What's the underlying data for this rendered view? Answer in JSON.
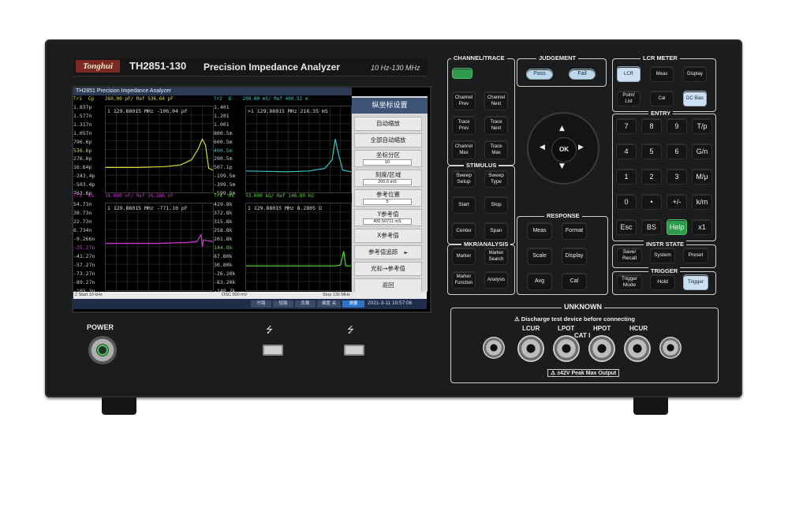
{
  "brand": {
    "logo": "Tonghui",
    "model": "TH2851-130",
    "title": "Precision Impedance  Analyzer",
    "freq_range": "10 Hz-130 MHz"
  },
  "screen": {
    "title": "TH2851 Precision Impedance Analyzer",
    "traces": [
      {
        "id": "Tr1",
        "param": "Cp",
        "scale": "260.00  pF/ Ref  536.64 pF",
        "color": "#d8d838",
        "ticks": [
          "1.837p",
          "1.577n",
          "1.317n",
          "1.057n",
          "796.6p",
          "536.6p",
          "276.6p",
          "16.64p",
          "-243.4p",
          "-503.4p",
          "763.6p"
        ],
        "marker": "1   129.88015 MHz   -106.04 pF",
        "curve": [
          [
            0,
            0.71
          ],
          [
            0.3,
            0.71
          ],
          [
            0.55,
            0.7
          ],
          [
            0.7,
            0.68
          ],
          [
            0.8,
            0.62
          ],
          [
            0.86,
            0.5
          ],
          [
            0.9,
            0.38
          ],
          [
            0.93,
            0.45
          ],
          [
            0.96,
            0.72
          ],
          [
            1,
            0.74
          ]
        ]
      },
      {
        "id": "Tr2",
        "param": "D",
        "scale": "200.00  mS/ Ref  400.51 m",
        "color": "#38c8c8",
        "ticks": [
          "1.401",
          "1.201",
          "1.001",
          "800.5m",
          "600.5m",
          "400.5m",
          "200.5m",
          "507.1p",
          "-199.5m",
          "-399.5m",
          "-599.5m"
        ],
        "marker": ">1   129.88015 MHz   216.35 mS",
        "curve": [
          [
            0,
            0.75
          ],
          [
            0.4,
            0.76
          ],
          [
            0.6,
            0.75
          ],
          [
            0.75,
            0.72
          ],
          [
            0.82,
            0.62
          ],
          [
            0.85,
            0.38
          ],
          [
            0.88,
            0.55
          ],
          [
            0.92,
            0.74
          ],
          [
            1,
            0.76
          ]
        ]
      },
      {
        "id": "Tr3",
        "param": "Cs",
        "scale": "16.000  nF/ Ref  26.266 nF",
        "color": "#d838d8",
        "ticks": [
          "54.73n",
          "38.73n",
          "22.73n",
          "6.734n",
          "-9.266n",
          "-25.27n",
          "-41.27n",
          "-57.27n",
          "-73.27n",
          "-89.27n",
          "-105.3n"
        ],
        "marker": "1   129.88015 MHz   -771.10 pF",
        "curve": [
          [
            0,
            0.46
          ],
          [
            0.5,
            0.46
          ],
          [
            0.75,
            0.45
          ],
          [
            0.85,
            0.44
          ],
          [
            0.89,
            0.36
          ],
          [
            0.9,
            0.5
          ],
          [
            0.91,
            0.42
          ],
          [
            0.95,
            0.43
          ],
          [
            1,
            0.44
          ]
        ]
      },
      {
        "id": "Tr4",
        "param": "Rs",
        "scale": "53.000  kΩ/ Ref  148.80 kΩ",
        "color": "#58d838",
        "ticks": [
          "429.8k",
          "372.8k",
          "315.8k",
          "258.8k",
          "201.8k",
          "144.8k",
          "87.80k",
          "30.80k",
          "-26.20k",
          "-83.20k",
          "-140.2k"
        ],
        "marker": "1   129.88015 MHz   8.2805 Ω",
        "curve": [
          [
            0,
            0.72
          ],
          [
            0.7,
            0.72
          ],
          [
            0.85,
            0.72
          ],
          [
            0.9,
            0.71
          ],
          [
            0.93,
            0.55
          ],
          [
            0.95,
            0.72
          ],
          [
            1,
            0.72
          ]
        ]
      }
    ],
    "status": {
      "start": "2  Start  10 kHz",
      "osc": "OSC 500 mV",
      "stop": "Stop  130 MHz"
    },
    "taskbar": [
      "开路",
      "短路",
      "负载",
      "偏置 关",
      "测量"
    ],
    "clock": "2021-3-11  10:57:06",
    "softmenu": {
      "title": "纵坐标设置",
      "items": [
        {
          "label": "自动缩放"
        },
        {
          "label": "全部自动缩放"
        },
        {
          "label": "坐标分区",
          "value": "10"
        },
        {
          "label": "刻度/区域",
          "value": "200.0 mS"
        },
        {
          "label": "参考位置",
          "value": "5"
        },
        {
          "label": "Y参考值",
          "value": "400.50711 mS"
        },
        {
          "label": "X参考值"
        },
        {
          "label": "参考值追踪",
          "arrow": "►"
        },
        {
          "label": "光标→参考值"
        },
        {
          "label": "返回"
        }
      ]
    }
  },
  "panel": {
    "power": "POWER",
    "channel": {
      "title": "CHANNEL/TRACE",
      "buttons": [
        "Channel\nPrev",
        "Channel\nNext",
        "Trace\nPrev",
        "Trace\nNext",
        "Channel\nMax",
        "Trace\nMax"
      ]
    },
    "judgement": {
      "title": "JUDGEMENT",
      "buttons": [
        "Pass",
        "Fail"
      ]
    },
    "lcr": {
      "title": "LCR METER",
      "buttons": [
        "LCR",
        "Meas",
        "Display",
        "Point/\nList",
        "Cal",
        "DC Bias"
      ]
    },
    "entry": {
      "title": "ENTRY",
      "keys": [
        "7",
        "8",
        "9",
        "T/p",
        "4",
        "5",
        "6",
        "G/n",
        "1",
        "2",
        "3",
        "M/μ",
        "0",
        "•",
        "+/-",
        "k/m",
        "Esc",
        "BS",
        "Help",
        "x1"
      ]
    },
    "stimulus": {
      "title": "STIMULUS",
      "buttons": [
        "Sweep\nSetup",
        "Sweep\nType",
        "Start",
        "Stop",
        "Center",
        "Span"
      ]
    },
    "nav": {
      "ok": "OK",
      "arrows": [
        "▲",
        "▼",
        "◀",
        "▶"
      ]
    },
    "response": {
      "title": "RESPONSE",
      "buttons": [
        "Meas",
        "Format",
        "Scale",
        "Display",
        "Avg",
        "Cal"
      ]
    },
    "mkr": {
      "title": "MKR/ANALYSIS",
      "buttons": [
        "Marker",
        "Marker\nSearch",
        "Marker\nFunction",
        "Analysis"
      ]
    },
    "instr": {
      "title": "INSTR STATE",
      "buttons": [
        "Save/\nRecall",
        "System",
        "Preset"
      ]
    },
    "trigger": {
      "title": "TRIGGER",
      "buttons": [
        "Trigger\nMode",
        "Hold",
        "Trigger"
      ]
    },
    "unknown": {
      "title": "UNKNOWN",
      "warning": "⚠ Discharge test device before connecting",
      "cat": "CAT I",
      "labels": [
        "LCUR",
        "LPOT",
        "HPOT",
        "HCUR"
      ],
      "max": "⚠ ±42V Peak Max Output"
    }
  }
}
